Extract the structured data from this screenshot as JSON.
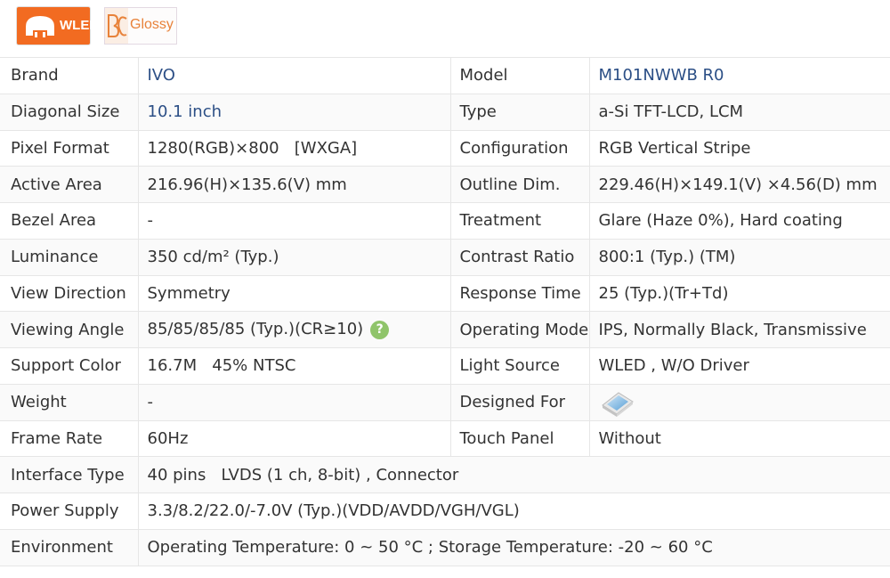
{
  "badges": {
    "wled": "WLED",
    "glossy": "Glossy"
  },
  "rows": [
    {
      "l1": "Brand",
      "v1": "IVO",
      "l2": "Model",
      "v2": "M101NWWB R0"
    },
    {
      "l1": "Diagonal Size",
      "v1": "10.1 inch",
      "l2": "Type",
      "v2": "a-Si TFT-LCD, LCM"
    },
    {
      "l1": "Pixel Format",
      "v1": "1280(RGB)×800   [WXGA]",
      "l2": "Configuration",
      "v2": "RGB Vertical Stripe"
    },
    {
      "l1": "Active Area",
      "v1": "216.96(H)×135.6(V) mm",
      "l2": "Outline Dim.",
      "v2": "229.46(H)×149.1(V) ×4.56(D) mm"
    },
    {
      "l1": "Bezel Area",
      "v1": "-",
      "l2": "Treatment",
      "v2": "Glare (Haze 0%), Hard coating"
    },
    {
      "l1": "Luminance",
      "v1": "350 cd/m² (Typ.)",
      "l2": "Contrast Ratio",
      "v2": "800:1 (Typ.) (TM)"
    },
    {
      "l1": "View Direction",
      "v1": "Symmetry",
      "l2": "Response Time",
      "v2": "25 (Typ.)(Tr+Td)"
    },
    {
      "l1": "Viewing Angle",
      "v1": "85/85/85/85 (Typ.)(CR≥10)",
      "help": "?",
      "l2": "Operating Mode",
      "v2": "IPS, Normally Black, Transmissive"
    },
    {
      "l1": "Support Color",
      "v1": "16.7M   45% NTSC",
      "l2": "Light Source",
      "v2": "WLED , W/O Driver"
    },
    {
      "l1": "Weight",
      "v1": "-",
      "l2": "Designed For",
      "v2_icon": "laptop-icon"
    },
    {
      "l1": "Frame Rate",
      "v1": "60Hz",
      "l2": "Touch Panel",
      "v2": "Without"
    },
    {
      "l1": "Interface Type",
      "v1": "40 pins   LVDS (1 ch, 8-bit) , Connector"
    },
    {
      "l1": "Power Supply",
      "v1": "3.3/8.2/22.0/-7.0V (Typ.)(VDD/AVDD/VGH/VGL)"
    },
    {
      "l1": "Environment",
      "v1": "Operating Temperature: 0 ~ 50 °C ; Storage Temperature: -20 ~ 60 °C"
    }
  ],
  "colors": {
    "link": "#2c4f86",
    "wled_badge": "#f26b21",
    "glossy_text": "#e8823a",
    "help_badge": "#8fc46a"
  }
}
